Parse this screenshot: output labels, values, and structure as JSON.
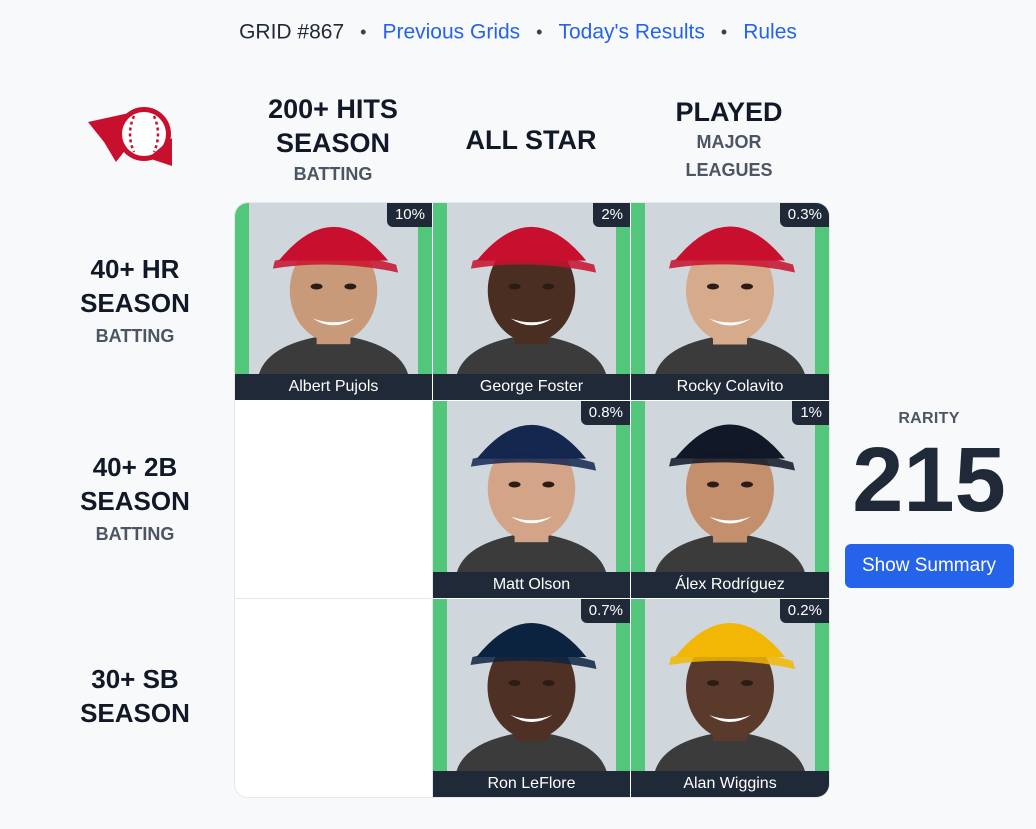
{
  "nav": {
    "title": "GRID #867",
    "dot": "•",
    "links": [
      "Previous Grids",
      "Today's Results",
      "Rules"
    ]
  },
  "columns": [
    {
      "main": "200+ HITS SEASON",
      "sub": "BATTING"
    },
    {
      "main": "ALL STAR",
      "sub": ""
    },
    {
      "main": "PLAYED",
      "sub": "MAJOR LEAGUES"
    }
  ],
  "rows": [
    {
      "main": "40+ HR SEASON",
      "sub": "BATTING"
    },
    {
      "main": "40+ 2B SEASON",
      "sub": "BATTING"
    },
    {
      "main": "30+ SB SEASON",
      "sub": ""
    }
  ],
  "cells": [
    [
      {
        "player": "Albert Pujols",
        "pct": "10%",
        "cap_color": "#c8102e",
        "skin": "#c89a7a"
      },
      {
        "player": "George Foster",
        "pct": "2%",
        "cap_color": "#c8102e",
        "skin": "#4a2e22"
      },
      {
        "player": "Rocky Colavito",
        "pct": "0.3%",
        "cap_color": "#c8102e",
        "skin": "#d6ab8c"
      }
    ],
    [
      null,
      {
        "player": "Matt Olson",
        "pct": "0.8%",
        "cap_color": "#13274f",
        "skin": "#d3a487"
      },
      {
        "player": "Álex Rodríguez",
        "pct": "1%",
        "cap_color": "#111827",
        "skin": "#c48f6c"
      }
    ],
    [
      null,
      {
        "player": "Ron LeFlore",
        "pct": "0.7%",
        "cap_color": "#0c2340",
        "skin": "#4f3024"
      },
      {
        "player": "Alan Wiggins",
        "pct": "0.2%",
        "cap_color": "#f2b705",
        "skin": "#5a3a2b"
      }
    ]
  ],
  "rarity": {
    "label": "RARITY",
    "value": "215",
    "button": "Show Summary"
  },
  "colors": {
    "accent": "#2563eb",
    "correct": "#52c77c",
    "dark": "#1f2937",
    "logo_red": "#c8102e"
  }
}
